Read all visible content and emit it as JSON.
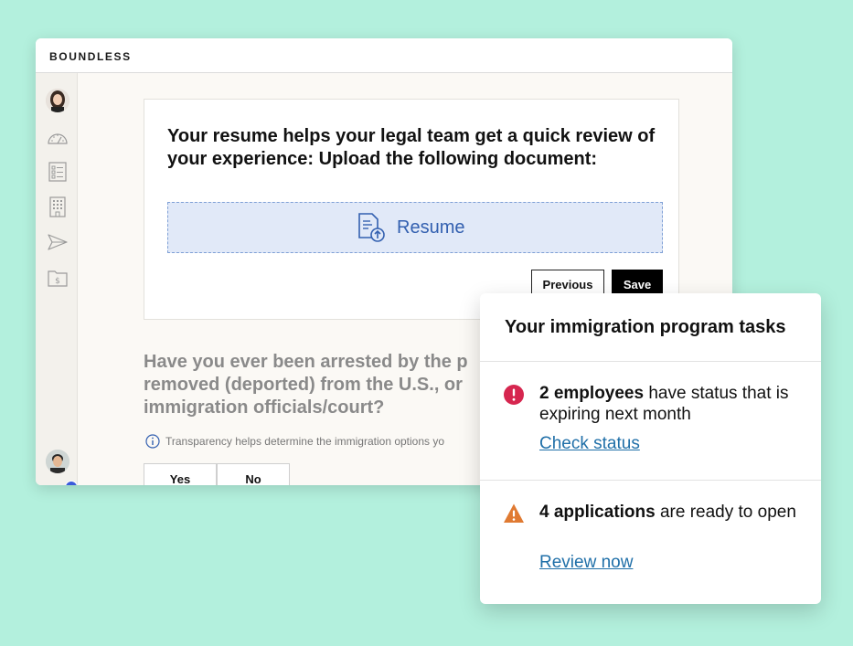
{
  "app": {
    "brand": "BOUNDLESS"
  },
  "sidebar": {
    "items": [
      {
        "icon": "user-avatar"
      },
      {
        "icon": "dashboard-gauge-icon"
      },
      {
        "icon": "form-list-icon"
      },
      {
        "icon": "building-icon"
      },
      {
        "icon": "send-icon"
      },
      {
        "icon": "billing-folder-icon"
      }
    ]
  },
  "upload_card": {
    "title": "Your resume helps your legal team get a quick review of your experience: Upload the following document:",
    "dropzone_label": "Resume",
    "previous_label": "Previous",
    "save_label": "Save"
  },
  "question": {
    "text": "Have you ever been arrested by the p\nremoved (deported) from the U.S., or\nimmigration officials/court?",
    "info": "Transparency helps determine the immigration options yo",
    "yes_label": "Yes",
    "no_label": "No"
  },
  "tasks": {
    "title": "Your immigration program tasks",
    "items": [
      {
        "bold": "2 employees",
        "rest": " have status that is expiring next month",
        "link": "Check status",
        "status_color": "#d6264f"
      },
      {
        "bold": "4 applications",
        "rest": " are ready to open",
        "link": "Review now",
        "status_color": "#e07a32"
      }
    ]
  },
  "colors": {
    "background": "#b3f0dd",
    "accent_blue": "#3360b0",
    "link": "#1f6fa8"
  }
}
